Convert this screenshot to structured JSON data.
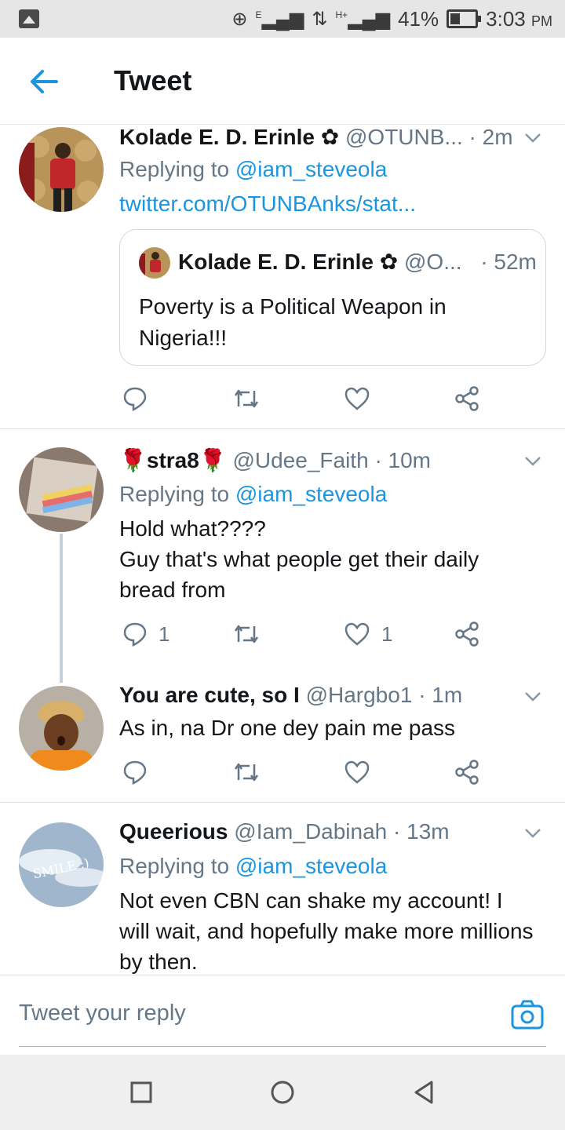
{
  "status_bar": {
    "battery": "41%",
    "time": "3:03",
    "ampm": "PM",
    "network_1": "E",
    "network_2": "H+"
  },
  "header": {
    "title": "Tweet"
  },
  "tweets": [
    {
      "name": "Kolade E. D. Erinle",
      "handle": "@OTUNB...",
      "time": "· 2m",
      "replying_prefix": "Replying to",
      "replying_to": "@iam_steveola",
      "link": "twitter.com/OTUNBAnks/stat...",
      "quote": {
        "name": "Kolade E. D. Erinle",
        "handle": "@O...",
        "time": "· 52m",
        "text": "Poverty is a Political Weapon in Nigeria!!!"
      }
    },
    {
      "name_prefix": "🌹",
      "name": "stra8",
      "name_suffix": "🌹",
      "handle": "@Udee_Faith",
      "time": "· 10m",
      "replying_prefix": "Replying to",
      "replying_to": "@iam_steveola",
      "text_line1": "Hold what????",
      "text_line2": "Guy that's what people get their daily bread from",
      "reply_count": "1",
      "like_count": "1"
    },
    {
      "name": "You are cute, so I",
      "handle": "@Hargbo1",
      "time": "· 1m",
      "text": "As in, na Dr one dey pain me pass"
    },
    {
      "name": "Queerious",
      "handle": "@Iam_Dabinah",
      "time": "· 13m",
      "replying_prefix": "Replying to",
      "replying_to": "@iam_steveola",
      "text": "Not even CBN can shake my account! I will wait, and hopefully make more millions by then.",
      "avatar_text": "SMILE :)"
    }
  ],
  "reply_bar": {
    "placeholder": "Tweet your reply"
  },
  "icons": {
    "back": "arrow-left-icon",
    "reply": "comment-icon",
    "retweet": "retweet-icon",
    "like": "heart-icon",
    "share": "share-icon",
    "camera": "camera-icon",
    "more": "chevron-down-icon"
  },
  "colors": {
    "accent": "#1b95e0",
    "muted": "#657786",
    "text": "#14171a",
    "divider": "#d8dee2"
  }
}
